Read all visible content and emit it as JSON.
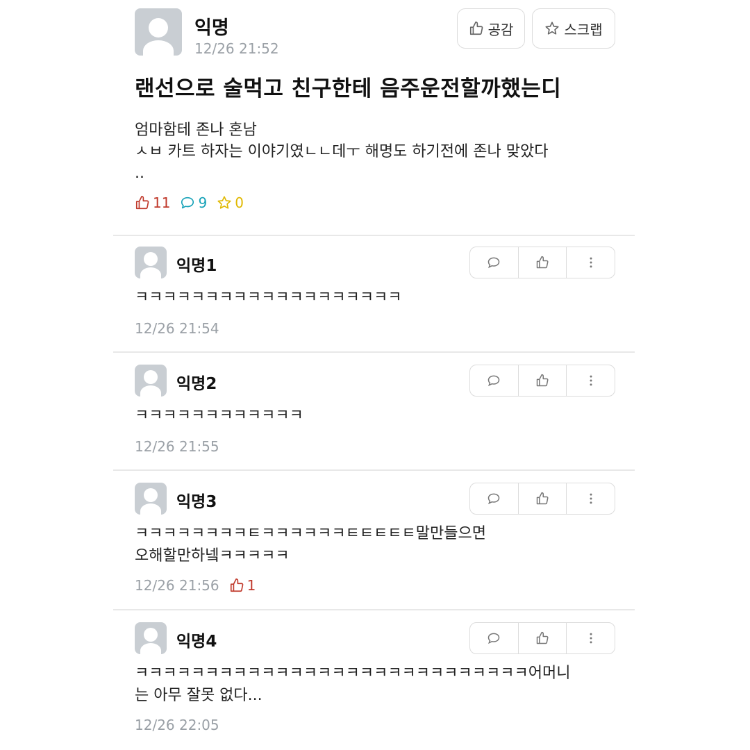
{
  "post": {
    "author": "익명",
    "time": "12/26 21:52",
    "buttons": {
      "empathy": "공감",
      "scrap": "스크랩"
    },
    "title": "랜선으로 술먹고 친구한테 음주운전할까했는디",
    "body": "엄마함테 존나 혼남\nㅅㅂ 카트 하자는 이야기였ㄴㄴ데ㅜ 해명도 하기전에 존나 맞았다\n..",
    "stats": {
      "likes": "11",
      "comments": "9",
      "scraps": "0"
    },
    "colors": {
      "like": "#c0392b",
      "comment": "#17a2b8",
      "scrap": "#e0b800"
    }
  },
  "comments": [
    {
      "author": "익명1",
      "text": "ㅋㅋㅋㅋㅋㅋㅋㅋㅋㅋㅋㅋㅋㅋㅋㅋㅋㅋㅋ",
      "time": "12/26 21:54",
      "likes": ""
    },
    {
      "author": "익명2",
      "text": "ㅋㅋㅋㅋㅋㅋㅋㅋㅋㅋㅋㅋ",
      "time": "12/26 21:55",
      "likes": ""
    },
    {
      "author": "익명3",
      "text": "ㅋㅋㅋㅋㅋㅋㅋㅋㅌㅋㅋㅋㅋㅋㅋㅌㅌㅌㅌㅌ말만들으면\n오해할만하넼ㅋㅋㅋㅋㅋ",
      "time": "12/26 21:56",
      "likes": "1"
    },
    {
      "author": "익명4",
      "text": "ㅋㅋㅋㅋㅋㅋㅋㅋㅋㅋㅋㅋㅋㅋㅋㅋㅋㅋㅋㅋㅋㅋㅋㅋㅋㅋㅋㅋ어머니\n는 아무 잘못 없다...",
      "time": "12/26 22:05",
      "likes": ""
    }
  ],
  "icons": [
    "thumbs-up-icon",
    "star-icon",
    "speech-bubble-icon",
    "more-vertical-icon",
    "avatar-icon"
  ]
}
